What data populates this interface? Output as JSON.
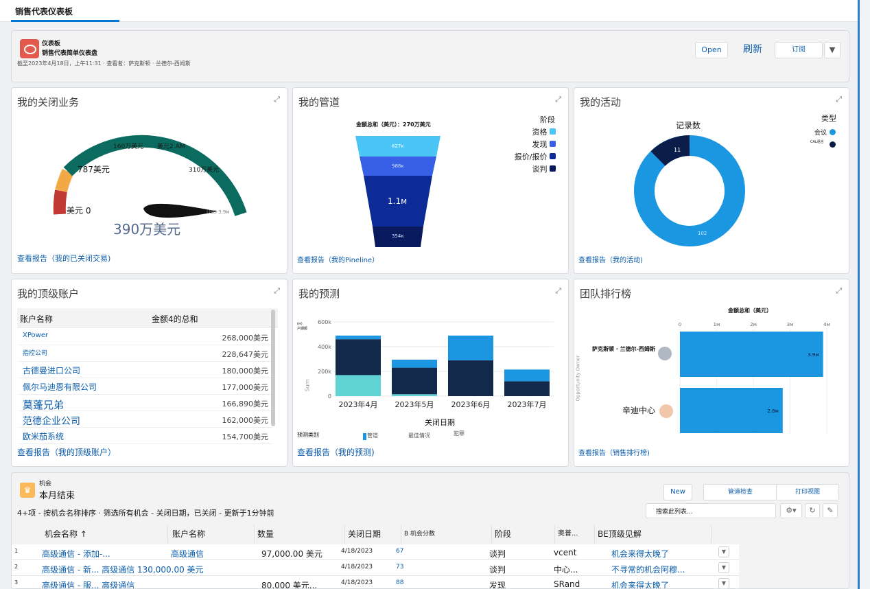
{
  "tab": {
    "label": "销售代表仪表板"
  },
  "header": {
    "type": "仪表板",
    "title": "销售代表简单仪表盘",
    "meta": "截至2023年4月18日，上午11:31 · 查看者：萨克斯顿 · 兰德尔-西姆斯",
    "open": "Open",
    "refresh": "刷新",
    "subscribe": "订阅"
  },
  "closed": {
    "title": "我的关闭业务",
    "labels": [
      "160万美元",
      "美元2.AM",
      "787美元",
      "310万美元",
      "美元 0",
      "USD 3.9м"
    ],
    "value": "390万美元",
    "link": "查看报告（我的已关闭交易)"
  },
  "pipeline": {
    "title": "我的管道",
    "total": "金额总和（美元）：270万美元",
    "legend_title": "阶段",
    "stages": [
      {
        "name": "资格",
        "value": "627к",
        "color": "#4bc5f5"
      },
      {
        "name": "发现",
        "value": "988к",
        "color": "#3860e6"
      },
      {
        "name": "报价/报价",
        "value": "1.1м",
        "color": "#0c2b96"
      },
      {
        "name": "谈判",
        "value": "354к",
        "color": "#0a1a5e"
      }
    ],
    "link": "查看报告（我的Pineline）"
  },
  "activity": {
    "title": "我的活动",
    "chart_title": "记录数",
    "legend_title": "类型",
    "items": [
      {
        "name": "会议",
        "value": "102",
        "color": "#1b96e0"
      },
      {
        "name": "CAL语言",
        "value": "11",
        "color": "#0b1e4a"
      }
    ],
    "link": "查看报告（我的活动)"
  },
  "accounts": {
    "title": "我的顶级账户",
    "col1": "账户名称",
    "col2": "金额4的总和",
    "rows": [
      {
        "name": "XPower",
        "value": "268,000美元"
      },
      {
        "name": "指控公司",
        "value": "228,647美元"
      },
      {
        "name": "古德曼进口公司",
        "value": "180,000美元"
      },
      {
        "name": "佩尔马迪恩有限公司",
        "value": "177,000美元"
      },
      {
        "name": "莫蓬兄弟",
        "value": "166,890美元"
      },
      {
        "name": "范德企业公司",
        "value": "162,000美元"
      },
      {
        "name": "欧米茄系统",
        "value": "154,700美元"
      }
    ],
    "link": "查看报告（我的顶级账户）"
  },
  "forecast": {
    "title": "我的预测",
    "ylabel": "(м)\n户期额",
    "side_label": "Sum",
    "xlabel": "关闭日期",
    "legend_title": "预测类别",
    "legend": [
      "管道",
      "最佳情况",
      "犯罪"
    ],
    "link": "查看报告（我的预测)"
  },
  "leaderboard": {
    "title": "团队排行榜",
    "chart_title": "金额总和（美元）",
    "ylabel": "Opportunity Owner",
    "ticks": [
      "0",
      "1м",
      "2м",
      "3м",
      "4м"
    ],
    "rows": [
      {
        "name": "萨克斯顿 · 兰德尔-西姆斯",
        "label": "3.9м"
      },
      {
        "name": "辛迪中心",
        "label": "2.8м"
      }
    ],
    "link": "查看报告（销售排行榜)"
  },
  "chart_data": [
    {
      "type": "bar",
      "title": "我的预测",
      "categories": [
        "2023年4月",
        "2023年5月",
        "2023年6月",
        "2023年7月"
      ],
      "ylim": [
        0,
        600
      ],
      "yticks": [
        "600k",
        "400k",
        "200k",
        "0"
      ],
      "series": [
        {
          "name": "犯罪",
          "values": [
            170,
            15,
            0,
            0
          ],
          "color": "#5fd3d3"
        },
        {
          "name": "管道",
          "values": [
            290,
            215,
            290,
            120
          ],
          "color": "#13294b"
        },
        {
          "name": "最佳情况",
          "values": [
            30,
            65,
            200,
            95
          ],
          "color": "#1b96e0"
        }
      ]
    },
    {
      "type": "bar",
      "title": "金额总和（美元）",
      "categories": [
        "萨克斯顿 · 兰德尔-西姆斯",
        "辛迪中心"
      ],
      "values": [
        3.9,
        2.8
      ],
      "xlim": [
        0,
        4
      ]
    }
  ],
  "opps": {
    "type": "机会",
    "title": "本月结束",
    "info": "4+项 - 按机会名称排序 · 筛选所有机会 - 关闭日期，已关闭 - 更新于1分钟前",
    "new": "New",
    "check": "管道检查",
    "print": "打印视图",
    "search": "搜索此列表...",
    "cols": [
      "机会名称 ↑",
      "账户名称",
      "数量",
      "关闭日期",
      "B 机会分数",
      "阶段",
      "奥普...",
      "BE顶级见解"
    ],
    "rows": [
      {
        "num": "1",
        "name": "高级通信 - 添加-...",
        "account": "高级通信",
        "amount": "97,000.00 美元",
        "date": "4/18/2023",
        "score": "67",
        "stage": "谈判",
        "owner": "vcent",
        "insight": "机会来得太晚了"
      },
      {
        "num": "2",
        "name": "高级通信 - 新... 高级通信 130,000.00 美元",
        "account": "",
        "amount": "",
        "date": "4/18/2023",
        "score": "73",
        "stage": "谈判",
        "owner": "中心...",
        "insight": "不寻常的机会阿穆..."
      },
      {
        "num": "3",
        "name": "高级通信 - 服... 高级通信",
        "account": "",
        "amount": "80,000 美元...",
        "date": "4/18/2023",
        "score": "88",
        "stage": "发现",
        "owner": "SRand",
        "insight": "机会来得太晚了"
      }
    ]
  }
}
